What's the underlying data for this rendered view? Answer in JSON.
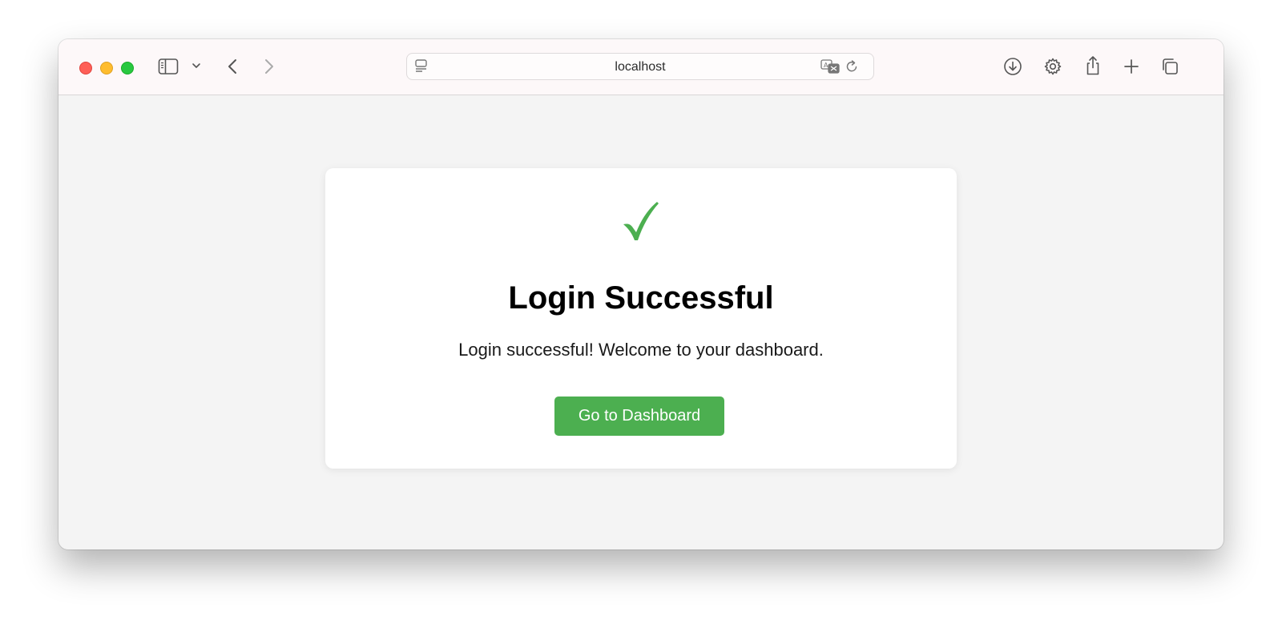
{
  "browser": {
    "address": "localhost",
    "icons": {
      "sidebar": "sidebar-icon",
      "sidebar_menu": "chevron-down-icon",
      "back": "chevron-left-icon",
      "forward": "chevron-right-icon",
      "reader": "reader-icon",
      "translate": "translate-icon",
      "reload": "reload-icon",
      "downloads": "download-icon",
      "settings": "gear-icon",
      "share": "share-icon",
      "new_tab": "plus-icon",
      "tabs": "tab-overview-icon"
    }
  },
  "page": {
    "check_glyph": "✓",
    "title": "Login Successful",
    "message": "Login successful! Welcome to your dashboard.",
    "button_label": "Go to Dashboard"
  },
  "colors": {
    "success": "#4caf50",
    "page_background": "#f4f4f4",
    "card_background": "#ffffff"
  }
}
